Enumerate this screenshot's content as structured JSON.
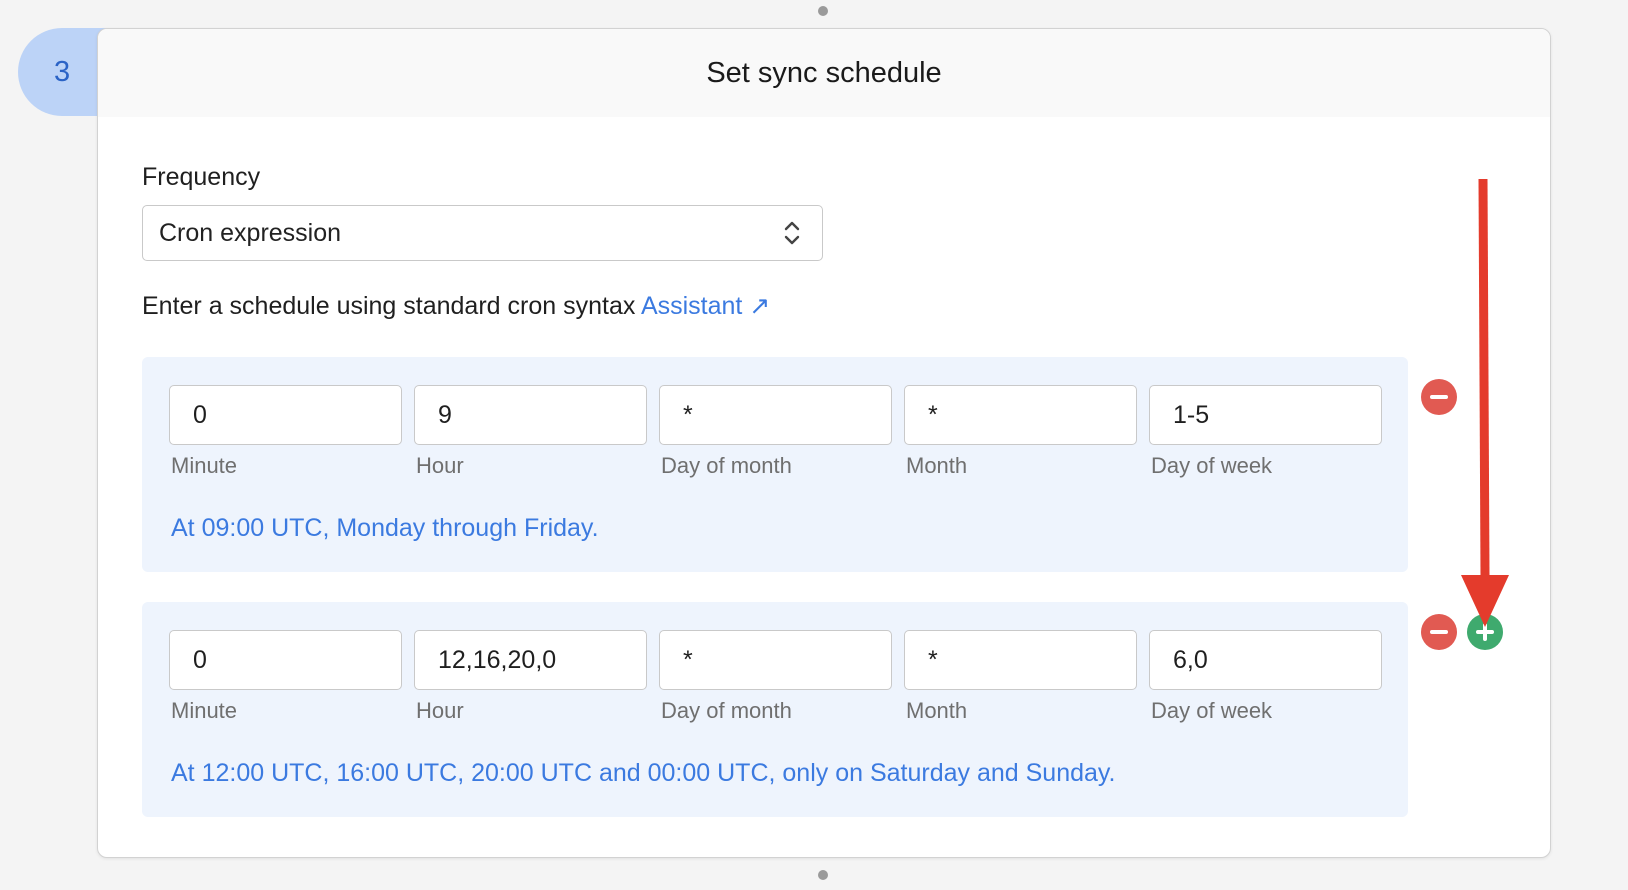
{
  "step": {
    "number": "3"
  },
  "card": {
    "title": "Set sync schedule"
  },
  "frequency": {
    "label": "Frequency",
    "selected": "Cron expression"
  },
  "help": {
    "text": "Enter a schedule using standard cron syntax",
    "link_label": "Assistant ↗"
  },
  "schedules": [
    {
      "fields": [
        {
          "value": "0",
          "label": "Minute"
        },
        {
          "value": "9",
          "label": "Hour"
        },
        {
          "value": "*",
          "label": "Day of month"
        },
        {
          "value": "*",
          "label": "Month"
        },
        {
          "value": "1-5",
          "label": "Day of week"
        }
      ],
      "description": "At 09:00 UTC, Monday through Friday."
    },
    {
      "fields": [
        {
          "value": "0",
          "label": "Minute"
        },
        {
          "value": "12,16,20,0",
          "label": "Hour"
        },
        {
          "value": "*",
          "label": "Day of month"
        },
        {
          "value": "*",
          "label": "Month"
        },
        {
          "value": "6,0",
          "label": "Day of week"
        }
      ],
      "description": "At 12:00 UTC, 16:00 UTC, 20:00 UTC and 00:00 UTC, only on Saturday and Sunday."
    }
  ],
  "colors": {
    "accent": "#3b7ae0",
    "remove": "#e15a52",
    "add": "#3faa6e",
    "annotation_arrow": "#e43b2c",
    "panel_bg": "#eef4fd",
    "badge_bg": "#bcd3f7"
  },
  "icons": [
    "chevron-up-down-icon",
    "minus-circle-icon",
    "plus-circle-icon",
    "arrow-down-annotation"
  ]
}
